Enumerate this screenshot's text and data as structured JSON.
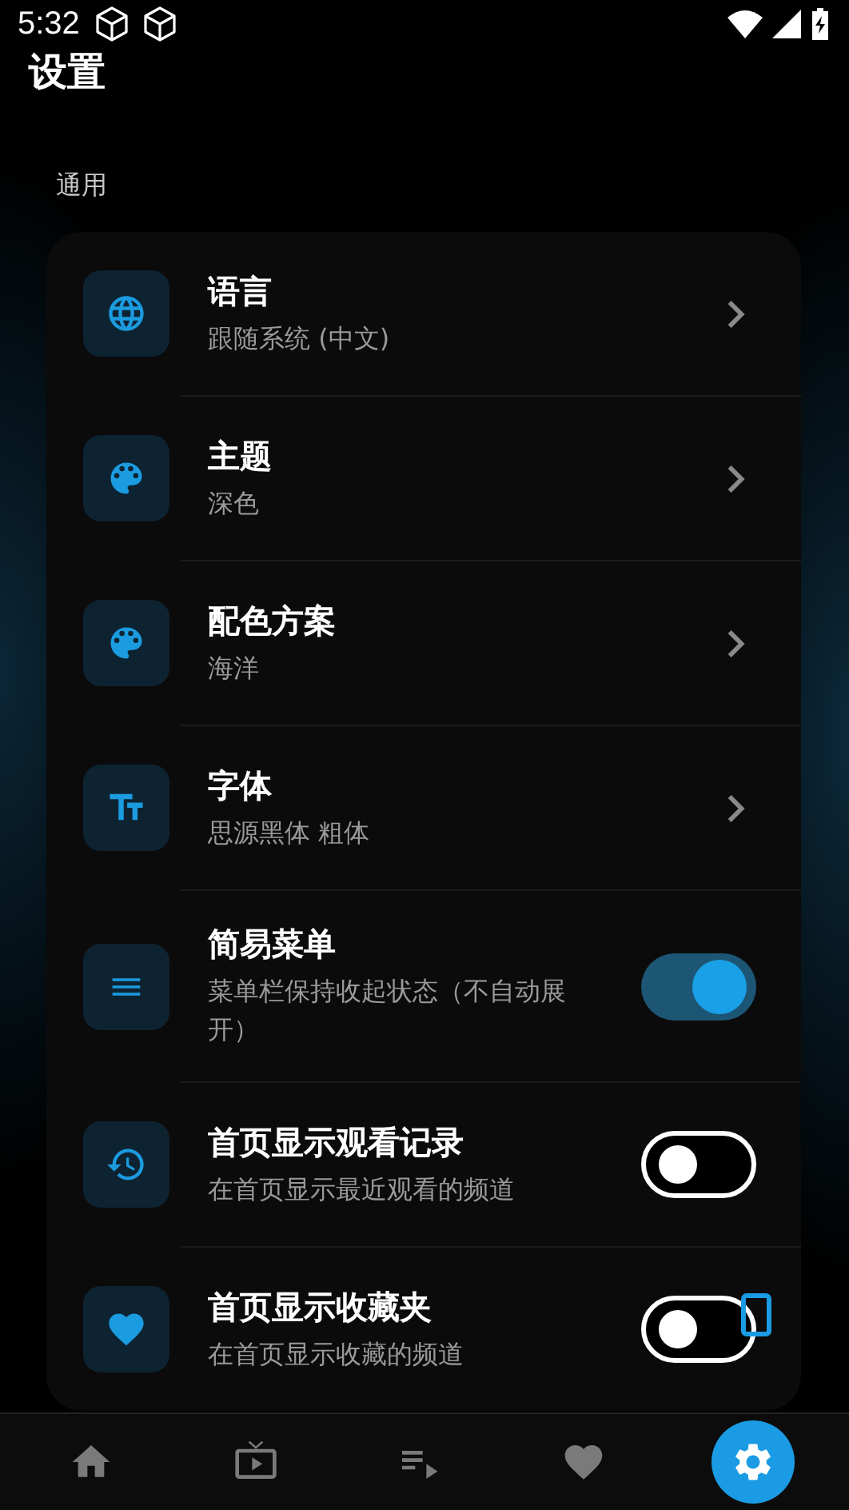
{
  "status_bar": {
    "time": "5:32"
  },
  "title": "设置",
  "section": "通用",
  "settings": [
    {
      "kind": "link",
      "title": "语言",
      "subtitle": "跟随系统 (中文)"
    },
    {
      "kind": "link",
      "title": "主题",
      "subtitle": "深色"
    },
    {
      "kind": "link",
      "title": "配色方案",
      "subtitle": "海洋"
    },
    {
      "kind": "link",
      "title": "字体",
      "subtitle": "思源黑体 粗体"
    },
    {
      "kind": "toggle",
      "title": "简易菜单",
      "subtitle": "菜单栏保持收起状态（不自动展开）",
      "on": true
    },
    {
      "kind": "toggle",
      "title": "首页显示观看记录",
      "subtitle": "在首页显示最近观看的频道",
      "on": false
    },
    {
      "kind": "toggle",
      "title": "首页显示收藏夹",
      "subtitle": "在首页显示收藏的频道",
      "on": false
    }
  ],
  "bottom_nav": [
    {
      "selected": false
    },
    {
      "selected": false
    },
    {
      "selected": false
    },
    {
      "selected": false
    },
    {
      "selected": true
    }
  ]
}
